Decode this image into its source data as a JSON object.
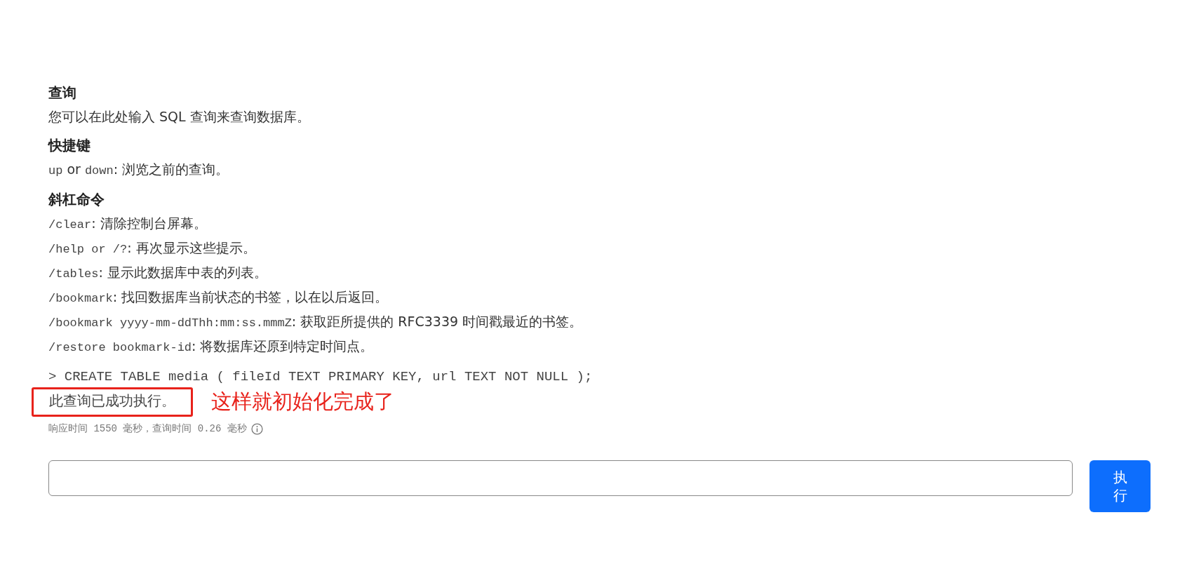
{
  "sections": [
    {
      "heading": "查询",
      "lines": [
        [
          {
            "kind": "text",
            "text": "您可以在此处输入 SQL 查询来查询数据库。"
          }
        ]
      ]
    },
    {
      "heading": "快捷键",
      "lines": [
        [
          {
            "kind": "code",
            "text": "up"
          },
          {
            "kind": "text",
            "text": " or "
          },
          {
            "kind": "code",
            "text": "down"
          },
          {
            "kind": "text",
            "text": ": 浏览之前的查询。"
          }
        ]
      ]
    },
    {
      "heading": "斜杠命令",
      "lines": [
        [
          {
            "kind": "code",
            "text": "/clear"
          },
          {
            "kind": "text",
            "text": ": 清除控制台屏幕。"
          }
        ],
        [
          {
            "kind": "code",
            "text": "/help or /?"
          },
          {
            "kind": "text",
            "text": ": 再次显示这些提示。"
          }
        ],
        [
          {
            "kind": "code",
            "text": "/tables"
          },
          {
            "kind": "text",
            "text": ": 显示此数据库中表的列表。"
          }
        ],
        [
          {
            "kind": "code",
            "text": "/bookmark"
          },
          {
            "kind": "text",
            "text": ": 找回数据库当前状态的书签，以在以后返回。"
          }
        ],
        [
          {
            "kind": "code",
            "text": "/bookmark yyyy-mm-ddThh:mm:ss.mmmZ"
          },
          {
            "kind": "text",
            "text": ": 获取距所提供的 RFC3339 时间戳最近的书签。"
          }
        ],
        [
          {
            "kind": "code",
            "text": "/restore bookmark-id"
          },
          {
            "kind": "text",
            "text": ": 将数据库还原到特定时间点。"
          }
        ]
      ]
    }
  ],
  "console": {
    "command": "> CREATE TABLE media ( fileId TEXT PRIMARY KEY, url TEXT NOT NULL );",
    "result": "此查询已成功执行。",
    "annotation": "这样就初始化完成了",
    "timing": "响应时间 1550 毫秒，查询时间 0.26 毫秒"
  },
  "query_input": {
    "button": "执行"
  }
}
